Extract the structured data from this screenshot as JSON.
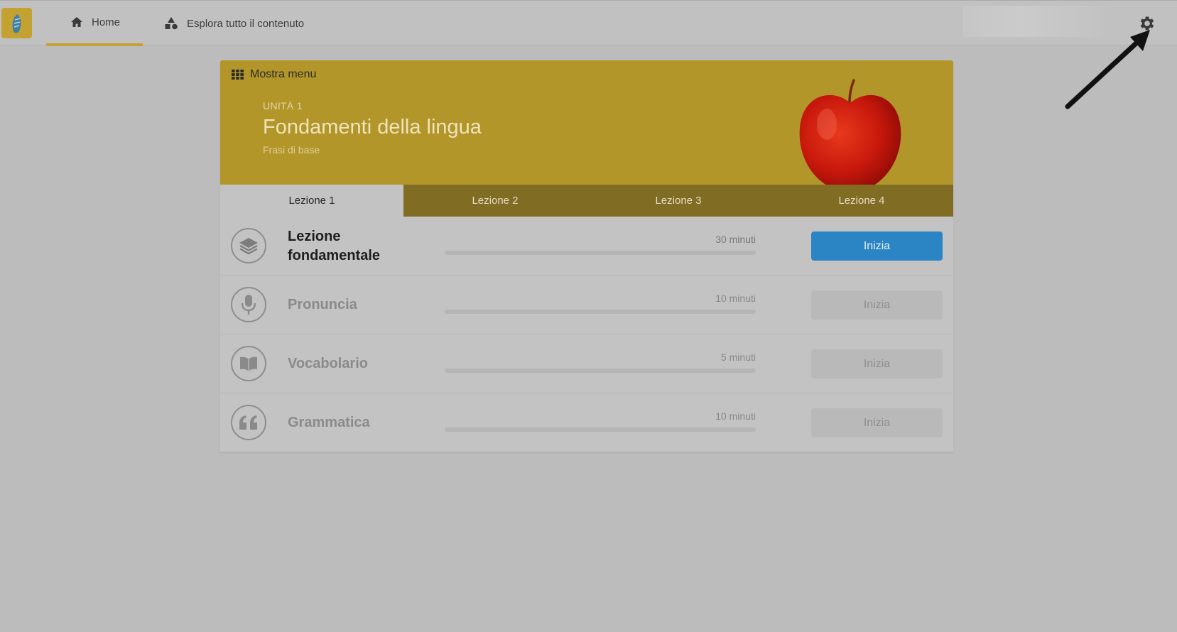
{
  "nav": {
    "home_label": "Home",
    "explore_label": "Esplora tutto il contenuto"
  },
  "icons": {
    "logo": "rosetta-logo-icon",
    "home": "home-icon",
    "explore": "shapes-icon",
    "settings": "gear-icon",
    "menu": "grid-icon"
  },
  "unit": {
    "menu_label": "Mostra menu",
    "label": "UNITÀ 1",
    "title": "Fondamenti della lingua",
    "subtitle": "Frasi di base"
  },
  "tabs": [
    {
      "label": "Lezione 1",
      "active": true
    },
    {
      "label": "Lezione 2",
      "active": false
    },
    {
      "label": "Lezione 3",
      "active": false
    },
    {
      "label": "Lezione 4",
      "active": false
    }
  ],
  "lessons": [
    {
      "title": "Lezione fondamentale",
      "duration": "30 minuti",
      "button": "Inizia",
      "icon": "layers-icon",
      "enabled": true
    },
    {
      "title": "Pronuncia",
      "duration": "10 minuti",
      "button": "Inizia",
      "icon": "microphone-icon",
      "enabled": false
    },
    {
      "title": "Vocabolario",
      "duration": "5 minuti",
      "button": "Inizia",
      "icon": "book-icon",
      "enabled": false
    },
    {
      "title": "Grammatica",
      "duration": "10 minuti",
      "button": "Inizia",
      "icon": "quote-icon",
      "enabled": false
    }
  ],
  "colors": {
    "brand": "#c3a232",
    "banner": "#b3962a",
    "tabs_bg": "#816c24",
    "start_button": "#2b85c5"
  }
}
